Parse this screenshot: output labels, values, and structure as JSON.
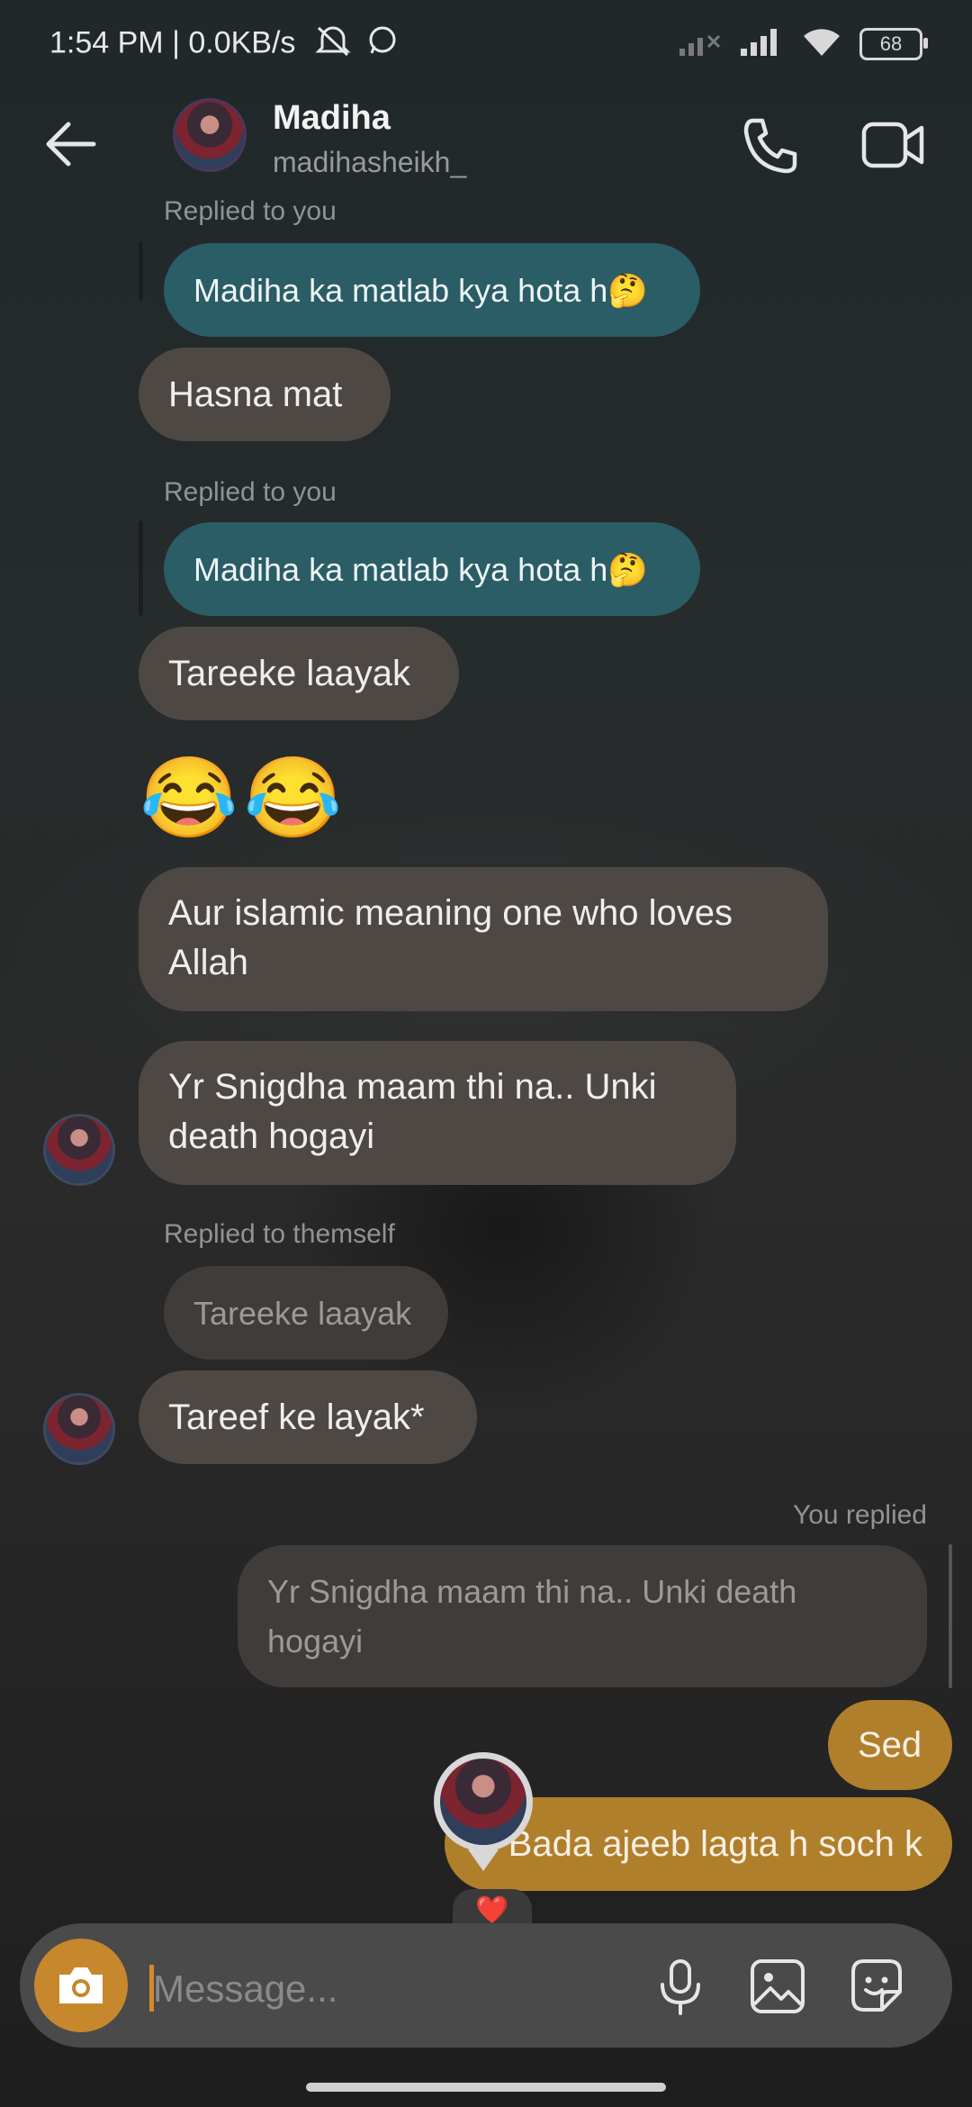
{
  "status_bar": {
    "time_info": "1:54 PM | 0.0KB/s",
    "battery": "68"
  },
  "header": {
    "name": "Madiha",
    "handle": "madihasheikh_"
  },
  "messages": {
    "m1_meta": "Replied to you",
    "m1_quote": "Madiha ka matlab kya hota h🤔",
    "m1_text": "Hasna mat",
    "m2_meta": "Replied to you",
    "m2_quote": "Madiha ka matlab kya hota h🤔",
    "m2_text": "Tareeke laayak",
    "m3_emoji": "😂😂",
    "m4_text": "Aur islamic meaning one who loves Allah",
    "m5_text": "Yr Snigdha maam thi na.. Unki death hogayi",
    "m6_meta": "Replied to themself",
    "m6_quote": "Tareeke laayak",
    "m6_text": "Tareef ke layak*",
    "m7_meta": "You replied",
    "m7_quote": "Yr Snigdha maam thi na.. Unki death hogayi",
    "m7_text": "Sed",
    "m8_text": "Bada ajeeb lagta h soch k",
    "reaction": "❤️"
  },
  "composer": {
    "placeholder": "Message..."
  },
  "colors": {
    "outgoing": "#b07f2c",
    "incoming": "#4e4844",
    "reply_teal": "#2a5d66",
    "camera_button": "#c7872d"
  },
  "icons": [
    "back-arrow-icon",
    "phone-icon",
    "video-icon",
    "camera-icon",
    "mic-icon",
    "gallery-icon",
    "sticker-icon",
    "wifi-icon",
    "signal-icon",
    "whatsapp-icon",
    "mute-icon"
  ]
}
